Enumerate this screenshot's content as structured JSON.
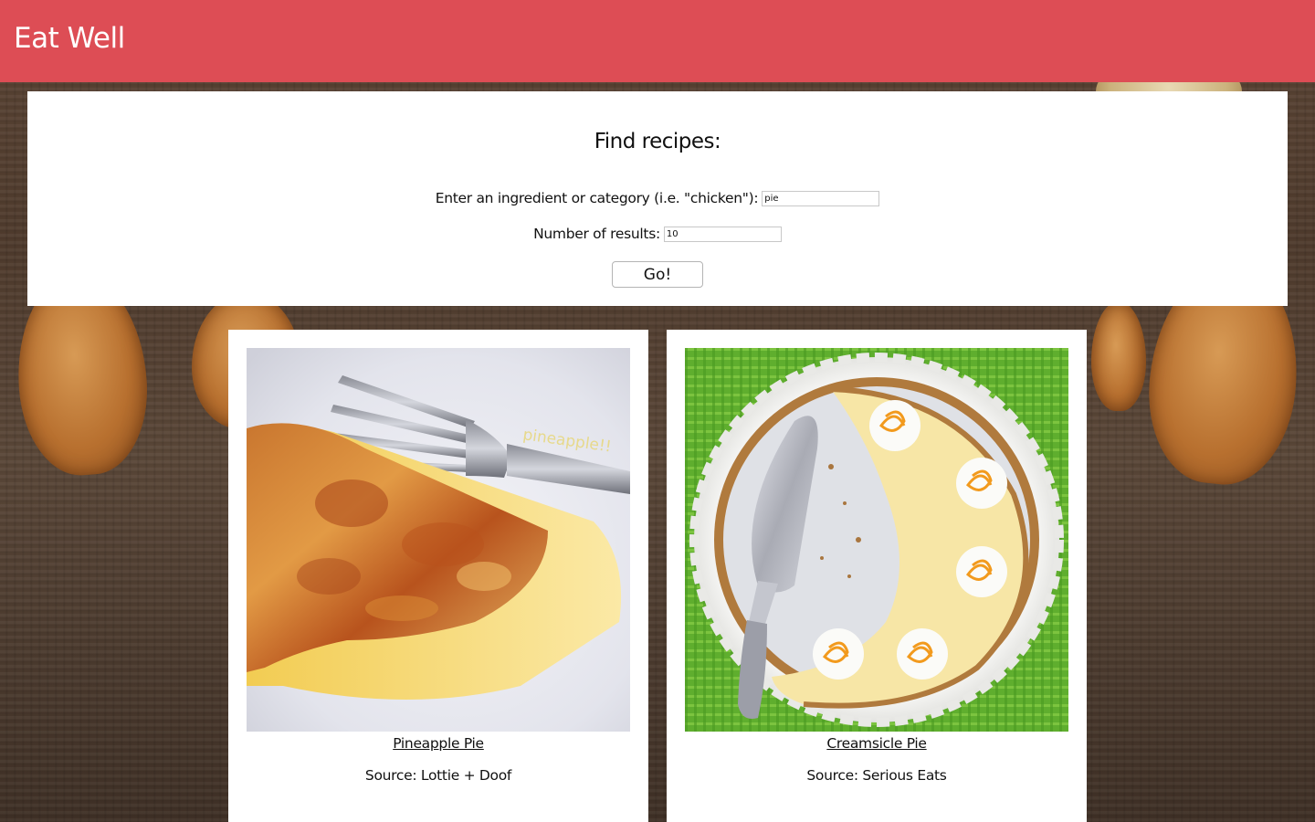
{
  "header": {
    "brand": "Eat Well"
  },
  "search": {
    "title": "Find recipes:",
    "ingredient_label": "Enter an ingredient or category (i.e. \"chicken\"):",
    "ingredient_value": "pie",
    "results_label": "Number of results:",
    "results_value": "10",
    "go_label": "Go!"
  },
  "results": [
    {
      "title": "Pineapple Pie",
      "source": "Source: Lottie + Doof",
      "image_icon": "pie-slice-with-fork",
      "watermark": "pineapple!!"
    },
    {
      "title": "Creamsicle Pie",
      "source": "Source: Serious Eats",
      "image_icon": "cream-pie-with-server"
    }
  ],
  "colors": {
    "header_bg": "#dd4d55",
    "panel_bg": "#ffffff"
  }
}
